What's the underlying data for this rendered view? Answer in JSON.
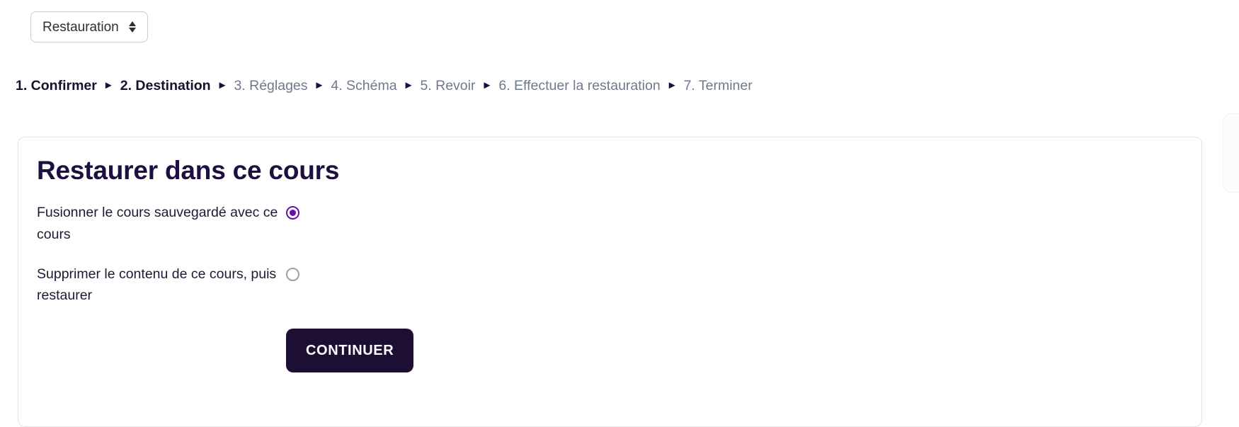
{
  "colors": {
    "accent_purple": "#6411b0",
    "dark_navy": "#1d0f33",
    "heading": "#1d1040",
    "muted_step": "#6e7a8a",
    "border": "#e3e4e8"
  },
  "select": {
    "value": "Restauration",
    "icon": "up-down-chevrons-icon"
  },
  "steps": [
    {
      "label": "1. Confirmer",
      "state": "done"
    },
    {
      "label": "2. Destination",
      "state": "current"
    },
    {
      "label": "3. Réglages",
      "state": "upcoming"
    },
    {
      "label": "4. Schéma",
      "state": "upcoming"
    },
    {
      "label": "5. Revoir",
      "state": "upcoming"
    },
    {
      "label": "6. Effectuer la restauration",
      "state": "upcoming"
    },
    {
      "label": "7. Terminer",
      "state": "upcoming"
    }
  ],
  "step_separator": "►",
  "card": {
    "title": "Restaurer dans ce cours",
    "options": [
      {
        "label": "Fusionner le cours sauvegardé avec ce cours",
        "selected": true
      },
      {
        "label": "Supprimer le contenu de ce cours, puis restaurer",
        "selected": false
      }
    ],
    "continue_label": "CONTINUER"
  }
}
